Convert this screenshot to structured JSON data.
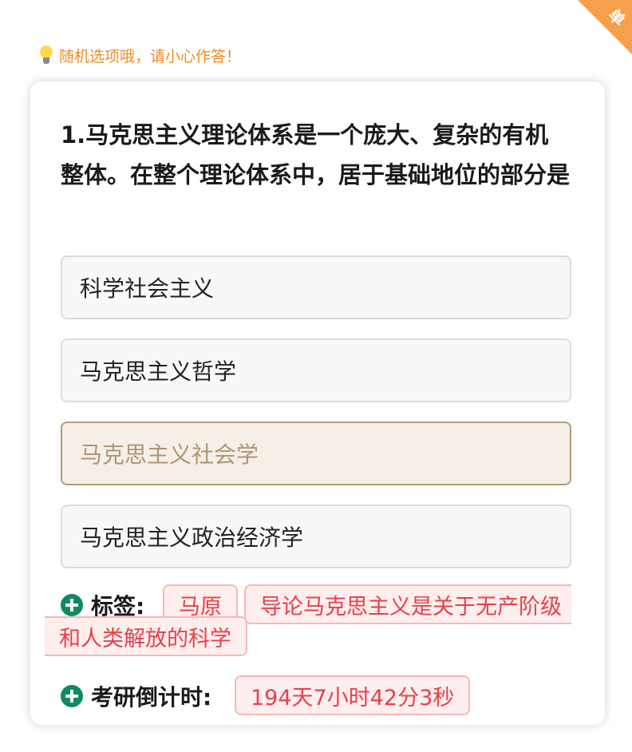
{
  "corner_badge": "单",
  "notice": {
    "icon": "lightbulb-icon",
    "text": "随机选项哦，请小心作答！"
  },
  "question": {
    "text": "1.马克思主义理论体系是一个庞大、复杂的有机整体。在整个理论体系中，居于基础地位的部分是"
  },
  "options": [
    {
      "label": "科学社会主义",
      "selected": false
    },
    {
      "label": "马克思主义哲学",
      "selected": false
    },
    {
      "label": "马克思主义社会学",
      "selected": true
    },
    {
      "label": "马克思主义政治经济学",
      "selected": false
    }
  ],
  "tags": {
    "label": "标签:",
    "items": [
      "马原",
      "导论马克思主义是关于无产阶级",
      "和人类解放的科学"
    ]
  },
  "countdown": {
    "label": "考研倒计时:",
    "value": "194天7小时42分3秒"
  },
  "colors": {
    "accent_orange": "#f5a04a",
    "selected_border": "#b79d7e",
    "tag_red": "#e8404a",
    "plus_green": "#0f8a5f"
  }
}
